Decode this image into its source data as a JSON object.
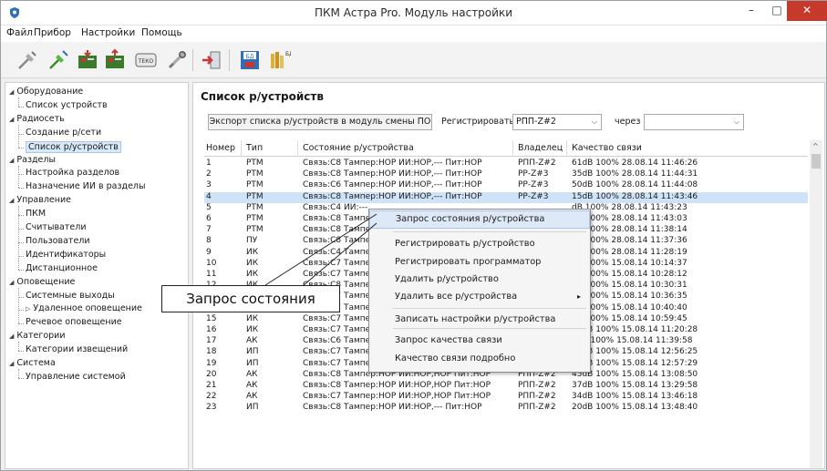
{
  "window": {
    "title": "ПКМ Астра Pro. Модуль настройки",
    "minimize": "–",
    "maximize": "□",
    "close": "✕"
  },
  "menu": [
    "Файл",
    "Прибор",
    "Настройки",
    "Помощь"
  ],
  "toolbar": {
    "icons": [
      "disconnect-icon",
      "connect-icon",
      "read-device-icon",
      "write-device-icon",
      "teko-icon",
      "tools-icon",
      "exit-icon",
      "save-db-icon",
      "load-db-icon"
    ],
    "teko_label": "ТЕКО",
    "save_label": "БД",
    "load_label": "БД"
  },
  "tree": [
    {
      "label": "Оборудование",
      "level": 0,
      "toggle": "◢"
    },
    {
      "label": "Список устройств",
      "level": 1
    },
    {
      "label": "Радиосеть",
      "level": 0,
      "toggle": "◢"
    },
    {
      "label": "Создание р/сети",
      "level": 1
    },
    {
      "label": "Список р/устройств",
      "level": 1,
      "selected": true
    },
    {
      "label": "Разделы",
      "level": 0,
      "toggle": "◢"
    },
    {
      "label": "Настройка разделов",
      "level": 1
    },
    {
      "label": "Назначение ИИ в разделы",
      "level": 1
    },
    {
      "label": "Управление",
      "level": 0,
      "toggle": "◢"
    },
    {
      "label": "ПКМ",
      "level": 1
    },
    {
      "label": "Считыватели",
      "level": 1
    },
    {
      "label": "Пользователи",
      "level": 1
    },
    {
      "label": "Идентификаторы",
      "level": 1
    },
    {
      "label": "Дистанционное",
      "level": 1
    },
    {
      "label": "Оповещение",
      "level": 0,
      "toggle": "◢"
    },
    {
      "label": "Системные выходы",
      "level": 1
    },
    {
      "label": "Удаленное оповещение",
      "level": 1,
      "toggle": "▷"
    },
    {
      "label": "Речевое оповещение",
      "level": 1
    },
    {
      "label": "Категории",
      "level": 0,
      "toggle": "◢"
    },
    {
      "label": "Категории извещений",
      "level": 1
    },
    {
      "label": "Система",
      "level": 0,
      "toggle": "◢"
    },
    {
      "label": "Управление системой",
      "level": 1
    }
  ],
  "main": {
    "title": "Список р/устройств",
    "export_button": "Экспорт списка р/устройств в модуль смены ПО",
    "register_label": "Регистрировать в",
    "register_value": "РПП-Z#2",
    "via_label": "через",
    "via_value": "",
    "combo_arrow": "⌵"
  },
  "table": {
    "headers": [
      "Номер",
      "Тип",
      "Состояние р/устройства",
      "Владелец",
      "Качество связи"
    ],
    "rows": [
      [
        "1",
        "РТМ",
        "Связь:С8 Тампер:НОР ИИ:НОР,--- Пит:НОР",
        "РПП-Z#2",
        "61dB 100% 28.08.14 11:46:26"
      ],
      [
        "2",
        "РТМ",
        "Связь:С8 Тампер:НОР ИИ:НОР,--- Пит:НОР",
        "РР-Z#3",
        "35dB 100% 28.08.14 11:44:31"
      ],
      [
        "3",
        "РТМ",
        "Связь:С6 Тампер:НОР ИИ:НОР,--- Пит:НОР",
        "РР-Z#3",
        "50dB 100% 28.08.14 11:44:08"
      ],
      [
        "4",
        "РТМ",
        "Связь:С8 Тампер:НОР ИИ:НОР,--- Пит:НОР",
        "РР-Z#3",
        "15dB 100% 28.08.14 11:43:46"
      ],
      [
        "5",
        "РТМ",
        "Связь:С4 ИИ:---",
        "",
        "dB 100% 28.08.14 11:43:23"
      ],
      [
        "6",
        "РТМ",
        "Связь:С8 Тампер",
        "",
        "dB 100% 28.08.14 11:43:03"
      ],
      [
        "7",
        "РТМ",
        "Связь:С8 Тампер",
        "",
        "dB 100% 28.08.14 11:38:14"
      ],
      [
        "8",
        "ПУ",
        "Связь:С8 Тампер",
        "",
        "dB 100% 28.08.14 11:37:36"
      ],
      [
        "9",
        "ИК",
        "Связь:С4 Тампер",
        "",
        "dB 100% 28.08.14 11:28:19"
      ],
      [
        "10",
        "ИК",
        "Связь:С7 Тампер",
        "",
        "dB 100% 15.08.14 10:14:37"
      ],
      [
        "11",
        "ИК",
        "Связь:С7 Тампер",
        "",
        "dB 100% 15.08.14 10:28:12"
      ],
      [
        "12",
        "ИК",
        "Связь:С8 Тампер",
        "",
        "dB 100% 15.08.14 10:30:31"
      ],
      [
        "13",
        "ИК",
        "Связь:С7 Тампер",
        "",
        "dB 100% 15.08.14 10:36:35"
      ],
      [
        "14",
        "ИК",
        "Связь:С7 Тампер",
        "",
        "dB 100% 15.08.14 10:40:40"
      ],
      [
        "15",
        "ИК",
        "Связь:С7 Тампер",
        "",
        "dB 100% 15.08.14 10:59:45"
      ],
      [
        "16",
        "ИК",
        "Связь:С7 Тампер:НОР ИИ:НОР Пит:НОР",
        "РПП-Z#2",
        "21dB 100% 15.08.14 11:20:28"
      ],
      [
        "17",
        "АК",
        "Связь:С6 Тампер:НОР ИИ:НОР,НОР Пит:НОР",
        "РПП-Z#2",
        "4dB 100% 15.08.14 11:39:58"
      ],
      [
        "18",
        "ИП",
        "Связь:С7 Тампер:НОР ИИ:НОР,--- Пит:НОР",
        "РПП-Z#2",
        "11dB 100% 15.08.14 12:56:25"
      ],
      [
        "19",
        "ИП",
        "Связь:С7 Тампер:НОР ИИ:НОР,--- Пит:НОР",
        "РПП-Z#2",
        "33dB 100% 15.08.14 12:57:29"
      ],
      [
        "20",
        "АК",
        "Связь:С8 Тампер:НОР ИИ:НОР,НОР Пит:НОР",
        "РПП-Z#2",
        "45dB 100% 15.08.14 13:08:50"
      ],
      [
        "21",
        "АК",
        "Связь:С8 Тампер:НОР ИИ:НОР,НОР Пит:НОР",
        "РПП-Z#2",
        "37dB 100% 15.08.14 13:29:58"
      ],
      [
        "22",
        "АК",
        "Связь:С7 Тампер:НОР ИИ:НОР,НОР Пит:НОР",
        "РПП-Z#2",
        "34dB 100% 15.08.14 13:46:18"
      ],
      [
        "23",
        "ИП",
        "Связь:С8 Тампер:НОР ИИ:НОР,--- Пит:НОР",
        "РПП-Z#2",
        "20dB 100% 15.08.14 13:48:40"
      ]
    ],
    "selected_row": 4
  },
  "scrollbar": {
    "up": "^"
  },
  "context_menu": {
    "items": [
      "Запрос состояния р/устройства",
      "Регистрировать р/устройство",
      "Регистрировать программатор",
      "Удалить р/устройство",
      "Удалить все р/устройства",
      "Записать настройки р/устройства",
      "Запрос качества связи",
      "Качество связи подробно"
    ],
    "submenu_arrow": "▸"
  },
  "callout": {
    "text": "Запрос состояния"
  },
  "colors": {
    "accent": "#2e6fb8",
    "selection": "#cfe3f8",
    "close": "#c7392b"
  }
}
